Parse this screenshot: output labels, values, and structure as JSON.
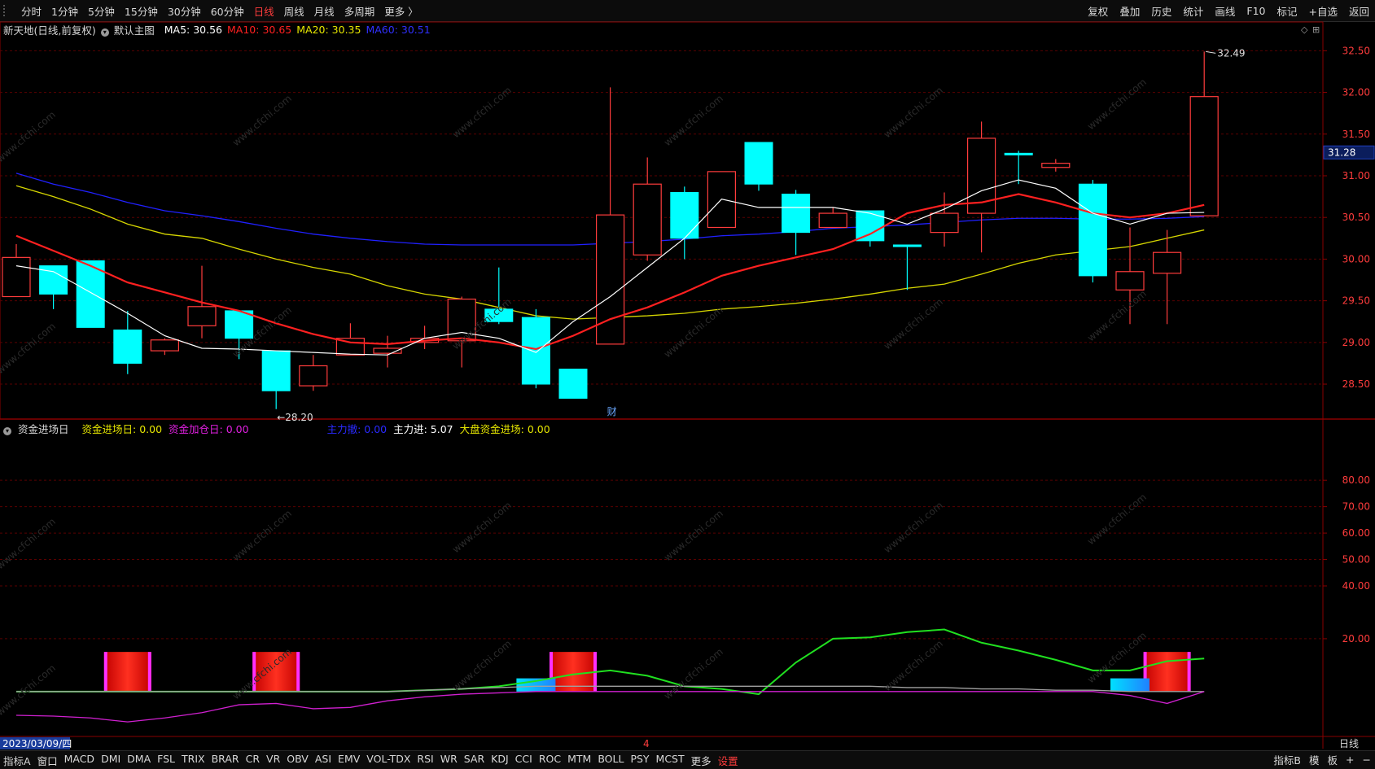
{
  "toolbar": {
    "timeframes": [
      "分时",
      "1分钟",
      "5分钟",
      "15分钟",
      "30分钟",
      "60分钟",
      "日线",
      "周线",
      "月线",
      "多周期",
      "更多 〉"
    ],
    "active_index": 6,
    "tools": [
      "复权",
      "叠加",
      "历史",
      "统计",
      "画线",
      "F10",
      "标记",
      "+自选",
      "返回"
    ]
  },
  "info": {
    "stock": "新天地(日线,前复权)",
    "main_chart_label": "默认主图",
    "ma5": "MA5: 30.56",
    "ma10": "MA10: 30.65",
    "ma20": "MA20: 30.35",
    "ma60": "MA60: 30.51"
  },
  "indicator_info": {
    "name": "资金进场日",
    "f1": "资金进场日: 0.00",
    "f2": "资金加仓日: 0.00",
    "f3": "主力撤: 0.00",
    "f4": "主力进: 5.07",
    "f5": "大盘资金进场: 0.00"
  },
  "labels": {
    "high": "32.49",
    "low": "←28.20",
    "current_price": "31.28",
    "date": "2023/03/09/四",
    "period": "日线",
    "finance_marker": "财",
    "x_mark": "4"
  },
  "bottombar": {
    "tabs": [
      "指标A",
      "窗口",
      "MACD",
      "DMI",
      "DMA",
      "FSL",
      "TRIX",
      "BRAR",
      "CR",
      "VR",
      "OBV",
      "ASI",
      "EMV",
      "VOL-TDX",
      "RSI",
      "WR",
      "SAR",
      "KDJ",
      "CCI",
      "ROC",
      "MTM",
      "BOLL",
      "PSY",
      "MCST",
      "更多",
      "设置"
    ],
    "right": [
      "指标B",
      "模",
      "板",
      "+",
      "−"
    ]
  },
  "colors": {
    "up": "#ff3c3c",
    "down": "#00ffff",
    "ma5": "#ffffff",
    "ma10": "#ff2020",
    "ma20": "#d6d600",
    "ma60": "#2020ff",
    "grid": "#5a0000",
    "axis": "#8a0000",
    "line_green": "#20e020",
    "line_magenta": "#d020d0",
    "line_gray": "#a0a0a0"
  },
  "chart_data": [
    {
      "type": "candlestick",
      "title": "新天地(日线,前复权)",
      "ylim": [
        28.1,
        32.65
      ],
      "yticks": [
        28.5,
        29.0,
        29.5,
        30.0,
        30.5,
        31.0,
        31.5,
        32.0,
        32.5
      ],
      "ytick_labels": [
        "28.50",
        "29.00",
        "29.50",
        "30.00",
        "30.50",
        "31.00",
        "31.50",
        "32.00",
        "32.50"
      ],
      "ohlc": [
        [
          29.55,
          30.18,
          29.55,
          30.02
        ],
        [
          29.92,
          29.92,
          29.4,
          29.58
        ],
        [
          29.98,
          29.98,
          29.18,
          29.18
        ],
        [
          29.15,
          29.38,
          28.62,
          28.75
        ],
        [
          28.9,
          29.05,
          28.85,
          29.03
        ],
        [
          29.2,
          29.92,
          29.05,
          29.43
        ],
        [
          29.38,
          29.38,
          28.8,
          29.05
        ],
        [
          28.9,
          28.9,
          28.2,
          28.42
        ],
        [
          28.48,
          28.85,
          28.42,
          28.72
        ],
        [
          28.85,
          29.23,
          28.85,
          29.05
        ],
        [
          28.87,
          29.08,
          28.7,
          28.93
        ],
        [
          29.0,
          29.2,
          28.92,
          29.05
        ],
        [
          29.02,
          29.55,
          28.7,
          29.52
        ],
        [
          29.4,
          29.9,
          29.22,
          29.25
        ],
        [
          29.3,
          29.4,
          28.45,
          28.5
        ],
        [
          28.68,
          28.68,
          28.33,
          28.33
        ],
        [
          28.98,
          32.06,
          28.98,
          30.53
        ],
        [
          30.05,
          31.22,
          29.98,
          30.9
        ],
        [
          30.8,
          30.87,
          30.0,
          30.25
        ],
        [
          30.38,
          31.05,
          30.38,
          31.05
        ],
        [
          31.4,
          31.4,
          30.82,
          30.9
        ],
        [
          30.78,
          30.83,
          30.05,
          30.32
        ],
        [
          30.38,
          30.62,
          30.38,
          30.55
        ],
        [
          30.58,
          30.58,
          30.15,
          30.22
        ],
        [
          30.17,
          30.17,
          29.63,
          30.15
        ],
        [
          30.32,
          30.8,
          30.15,
          30.55
        ],
        [
          30.55,
          31.65,
          30.08,
          31.45
        ],
        [
          31.27,
          31.3,
          30.9,
          31.25
        ],
        [
          31.1,
          31.2,
          31.05,
          31.15
        ],
        [
          30.9,
          30.95,
          29.72,
          29.8
        ],
        [
          29.63,
          30.38,
          29.22,
          29.85
        ],
        [
          29.83,
          30.35,
          29.22,
          30.08
        ],
        [
          30.52,
          32.49,
          30.52,
          31.95
        ]
      ],
      "ma5": [
        29.92,
        29.85,
        29.6,
        29.35,
        29.08,
        28.93,
        28.92,
        28.9,
        28.88,
        28.86,
        28.85,
        29.05,
        29.12,
        29.05,
        28.88,
        29.25,
        29.55,
        29.9,
        30.25,
        30.72,
        30.62,
        30.62,
        30.62,
        30.55,
        30.42,
        30.6,
        30.82,
        30.95,
        30.85,
        30.55,
        30.42,
        30.55,
        30.56
      ],
      "ma10": [
        30.28,
        30.1,
        29.92,
        29.72,
        29.6,
        29.48,
        29.38,
        29.23,
        29.1,
        29.0,
        28.98,
        29.02,
        29.05,
        29.0,
        28.92,
        29.08,
        29.28,
        29.42,
        29.6,
        29.8,
        29.92,
        30.02,
        30.12,
        30.3,
        30.55,
        30.65,
        30.68,
        30.78,
        30.68,
        30.55,
        30.5,
        30.55,
        30.65
      ],
      "ma20": [
        30.88,
        30.75,
        30.6,
        30.42,
        30.3,
        30.25,
        30.12,
        30.0,
        29.9,
        29.82,
        29.68,
        29.58,
        29.52,
        29.42,
        29.32,
        29.28,
        29.3,
        29.32,
        29.35,
        29.4,
        29.43,
        29.47,
        29.52,
        29.58,
        29.65,
        29.7,
        29.82,
        29.95,
        30.05,
        30.1,
        30.15,
        30.25,
        30.35
      ],
      "ma60": [
        31.03,
        30.9,
        30.8,
        30.68,
        30.58,
        30.52,
        30.45,
        30.37,
        30.3,
        30.25,
        30.21,
        30.18,
        30.17,
        30.17,
        30.17,
        30.17,
        30.19,
        30.21,
        30.24,
        30.28,
        30.3,
        30.33,
        30.37,
        30.39,
        30.41,
        30.44,
        30.47,
        30.49,
        30.49,
        30.48,
        30.48,
        30.49,
        30.51
      ],
      "high_label": "32.49",
      "low_label": "28.20",
      "current_price": 31.28
    },
    {
      "type": "indicator",
      "title": "资金进场日",
      "ylim": [
        -17,
        97
      ],
      "yticks": [
        20,
        40,
        50,
        60,
        70,
        80
      ],
      "ytick_labels": [
        "20.00",
        "40.00",
        "50.00",
        "60.00",
        "70.00",
        "80.00"
      ],
      "bars": [
        {
          "index": 3,
          "value": 15,
          "color": "red"
        },
        {
          "index": 7,
          "value": 15,
          "color": "red"
        },
        {
          "index": 15,
          "value": 15,
          "color": "red"
        },
        {
          "index": 31,
          "value": 15,
          "color": "red"
        },
        {
          "index": 14,
          "value": 5,
          "color": "cyan"
        },
        {
          "index": 30,
          "value": 5,
          "color": "cyan"
        }
      ],
      "series": [
        {
          "name": "",
          "color": "green",
          "values": [
            0,
            0,
            0,
            0,
            0,
            0,
            0,
            0,
            0,
            0,
            0,
            0.5,
            1,
            2,
            4,
            6.5,
            8,
            6,
            2,
            1,
            -1,
            11,
            20,
            20.5,
            22.5,
            23.5,
            18.5,
            15.5,
            12,
            8,
            8,
            11.5,
            12.5
          ]
        },
        {
          "name": "",
          "color": "gray",
          "values": [
            0,
            0,
            0,
            0,
            0,
            0,
            0,
            0,
            0,
            0,
            0,
            0.5,
            1,
            1.5,
            2,
            2,
            2,
            2,
            2,
            2,
            2,
            2,
            2,
            2,
            1.5,
            1.5,
            1,
            1,
            0.5,
            0.5,
            0,
            0,
            0
          ]
        },
        {
          "name": "",
          "color": "magenta",
          "values": [
            -9,
            -9.3,
            -10,
            -11.5,
            -10,
            -8,
            -5,
            -4.5,
            -6.5,
            -6,
            -3.5,
            -2,
            -1,
            -0.5,
            0,
            0,
            0,
            0,
            0,
            0,
            0,
            0,
            0,
            0,
            0,
            0,
            0,
            0,
            0,
            0,
            -1.5,
            -4.5,
            0
          ]
        }
      ]
    }
  ]
}
